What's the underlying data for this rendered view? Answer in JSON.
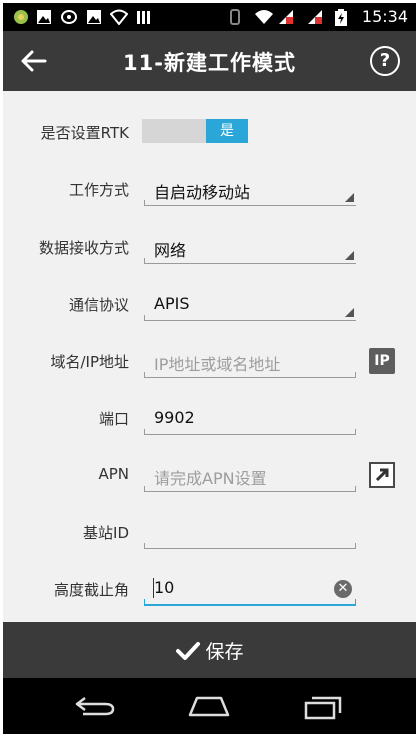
{
  "status_bar": {
    "time": "15:34",
    "icons": [
      "app-icon",
      "image-icon",
      "usb-icon",
      "image-icon",
      "wifi-icon",
      "signal-icon",
      "vibrate-icon",
      "wifi-icon",
      "mobile-data-icon",
      "mobile-data-icon",
      "battery-charging-icon"
    ]
  },
  "header": {
    "title": "11-新建工作模式",
    "help_label": "?"
  },
  "form": {
    "rtk": {
      "label": "是否设置RTK",
      "toggle_on_text": "是"
    },
    "work_mode": {
      "label": "工作方式",
      "value": "自启动移动站"
    },
    "data_receive": {
      "label": "数据接收方式",
      "value": "网络"
    },
    "protocol": {
      "label": "通信协议",
      "value": "APIS"
    },
    "domain_ip": {
      "label": "域名/IP地址",
      "placeholder": "IP地址或域名地址",
      "button_label": "IP"
    },
    "port": {
      "label": "端口",
      "value": "9902"
    },
    "apn": {
      "label": "APN",
      "placeholder": "请完成APN设置"
    },
    "base_id": {
      "label": "基站ID",
      "value": ""
    },
    "height_cutoff": {
      "label": "高度截止角",
      "value": "10"
    }
  },
  "footer": {
    "save_label": "保存"
  },
  "colors": {
    "accent": "#2ba6d9",
    "bar": "#3a3a3a",
    "background": "#f1f1f1"
  }
}
